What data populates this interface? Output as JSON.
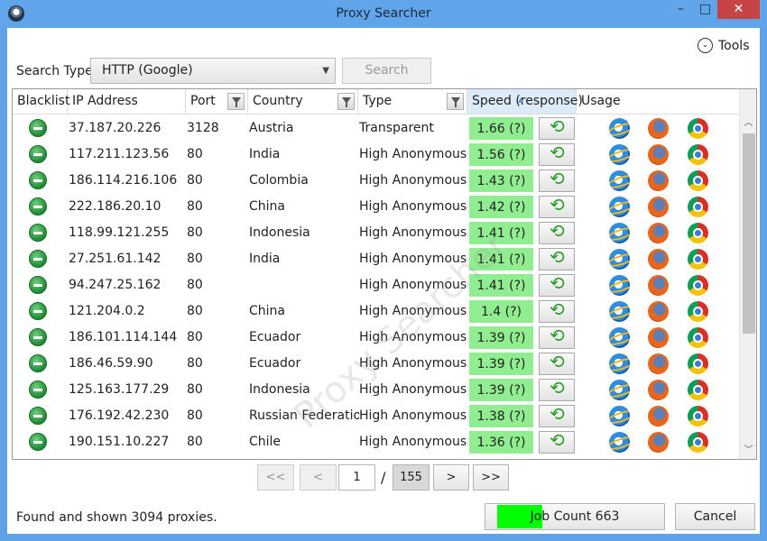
{
  "window": {
    "title": "Proxy Searcher",
    "minimize": "–",
    "maximize": "□",
    "close": "✕"
  },
  "toolbar": {
    "tools_label": "Tools",
    "tools_glyph": "⌄"
  },
  "search": {
    "type_label": "Search Type",
    "type_value": "HTTP (Google)",
    "button_label": "Search"
  },
  "grid": {
    "columns": [
      "Blacklist",
      "IP Address",
      "Port",
      "Country",
      "Type",
      "Speed (response)",
      "Usage"
    ],
    "sort_column": "Speed (response)",
    "sort_direction": "descending",
    "rows": [
      {
        "ip": "37.187.20.226",
        "port": "3128",
        "country": "Austria",
        "type": "Transparent",
        "speed": "1.66 (?)"
      },
      {
        "ip": "117.211.123.56",
        "port": "80",
        "country": "India",
        "type": "High Anonymous",
        "speed": "1.56 (?)"
      },
      {
        "ip": "186.114.216.106",
        "port": "80",
        "country": "Colombia",
        "type": "High Anonymous",
        "speed": "1.43 (?)"
      },
      {
        "ip": "222.186.20.10",
        "port": "80",
        "country": "China",
        "type": "High Anonymous",
        "speed": "1.42 (?)"
      },
      {
        "ip": "118.99.121.255",
        "port": "80",
        "country": "Indonesia",
        "type": "High Anonymous",
        "speed": "1.41 (?)"
      },
      {
        "ip": "27.251.61.142",
        "port": "80",
        "country": "India",
        "type": "High Anonymous",
        "speed": "1.41 (?)"
      },
      {
        "ip": "94.247.25.162",
        "port": "80",
        "country": "",
        "type": "High Anonymous",
        "speed": "1.41 (?)"
      },
      {
        "ip": "121.204.0.2",
        "port": "80",
        "country": "China",
        "type": "High Anonymous",
        "speed": "1.4 (?)"
      },
      {
        "ip": "186.101.114.144",
        "port": "80",
        "country": "Ecuador",
        "type": "High Anonymous",
        "speed": "1.39 (?)"
      },
      {
        "ip": "186.46.59.90",
        "port": "80",
        "country": "Ecuador",
        "type": "High Anonymous",
        "speed": "1.39 (?)"
      },
      {
        "ip": "125.163.177.29",
        "port": "80",
        "country": "Indonesia",
        "type": "High Anonymous",
        "speed": "1.39 (?)"
      },
      {
        "ip": "176.192.42.230",
        "port": "80",
        "country": "Russian Federation",
        "type": "High Anonymous",
        "speed": "1.38 (?)"
      },
      {
        "ip": "190.151.10.227",
        "port": "80",
        "country": "Chile",
        "type": "High Anonymous",
        "speed": "1.36 (?)"
      }
    ],
    "usage_icons": [
      "internet-explorer-icon",
      "firefox-icon",
      "chrome-icon"
    ],
    "speed_color": "#90ee90"
  },
  "watermark": "Proxy Searcher",
  "pager": {
    "first": "<<",
    "prev": "<",
    "current_page": "1",
    "separator": "/",
    "total_pages": "155",
    "next": ">",
    "last": ">>"
  },
  "status": {
    "text": "Found and shown 3094 proxies."
  },
  "job": {
    "label": "Job Count 663",
    "progress": 0.25,
    "progress_color": "#00ff00"
  },
  "cancel_label": "Cancel",
  "colors": {
    "titlebar": "#60a4e9",
    "close_button": "#c74444"
  }
}
